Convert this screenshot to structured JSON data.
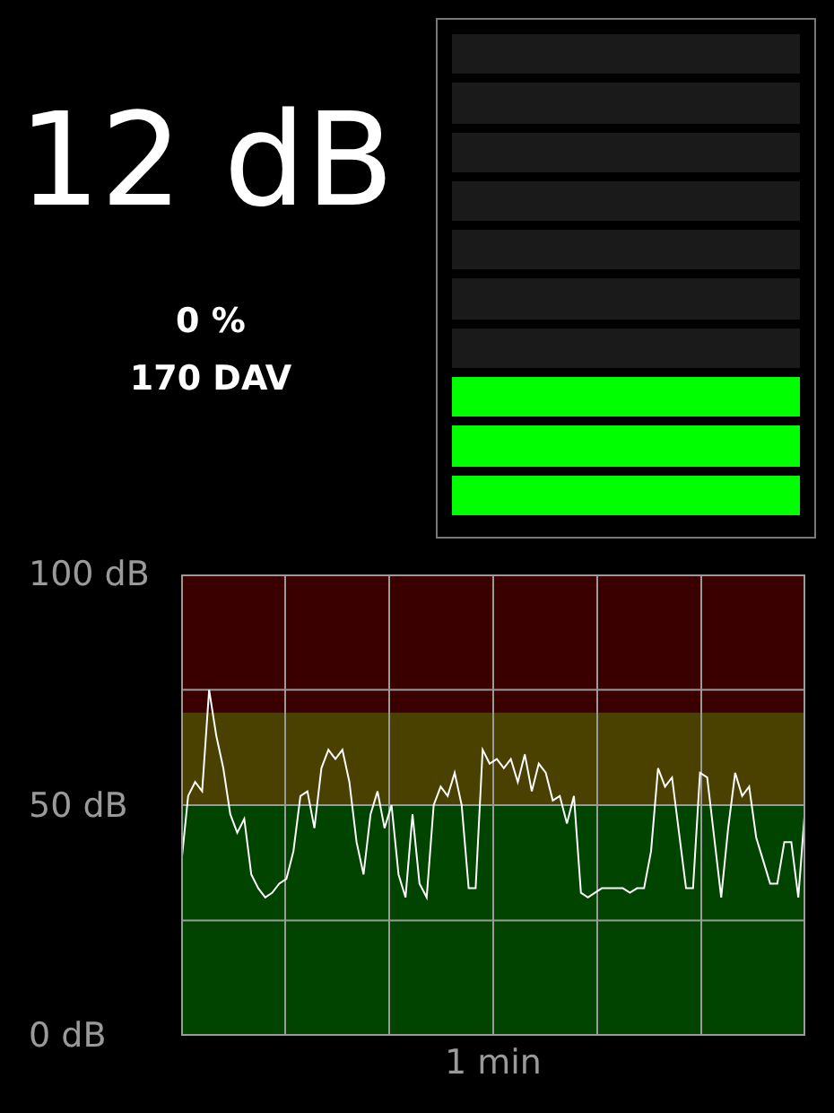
{
  "reading": "12 dB",
  "stats": [
    {
      "text": "0 %"
    },
    {
      "text": "170 DAV"
    }
  ],
  "meter": {
    "level": 0.3
  },
  "chart": {
    "chart_data": {
      "type": "line",
      "xlabel": "1 min",
      "ylim": [
        0,
        100
      ],
      "yticks": [
        {
          "value": 0,
          "label": "0 dB"
        },
        {
          "value": 50,
          "label": "50 dB"
        },
        {
          "value": 100,
          "label": "100 dB"
        }
      ],
      "series": [
        {
          "color": "#ffffff",
          "values": [
            37,
            52,
            55,
            53,
            75,
            65,
            58,
            48,
            44,
            47,
            35,
            32,
            30,
            31,
            33,
            34,
            40,
            52,
            53,
            45,
            58,
            62,
            60,
            62,
            55,
            42,
            35,
            48,
            53,
            45,
            50,
            35,
            30,
            48,
            33,
            30,
            50,
            54,
            52,
            57,
            50,
            32,
            32,
            62,
            59,
            60,
            58,
            60,
            55,
            61,
            53,
            59,
            57,
            51,
            52,
            46,
            52,
            31,
            30,
            31,
            32,
            32,
            32,
            32,
            31,
            32,
            32,
            40,
            58,
            54,
            56,
            44,
            32,
            32,
            57,
            56,
            43,
            30,
            45,
            57,
            52,
            54,
            43,
            38,
            33,
            33,
            42,
            42,
            30,
            50
          ]
        }
      ]
    }
  }
}
